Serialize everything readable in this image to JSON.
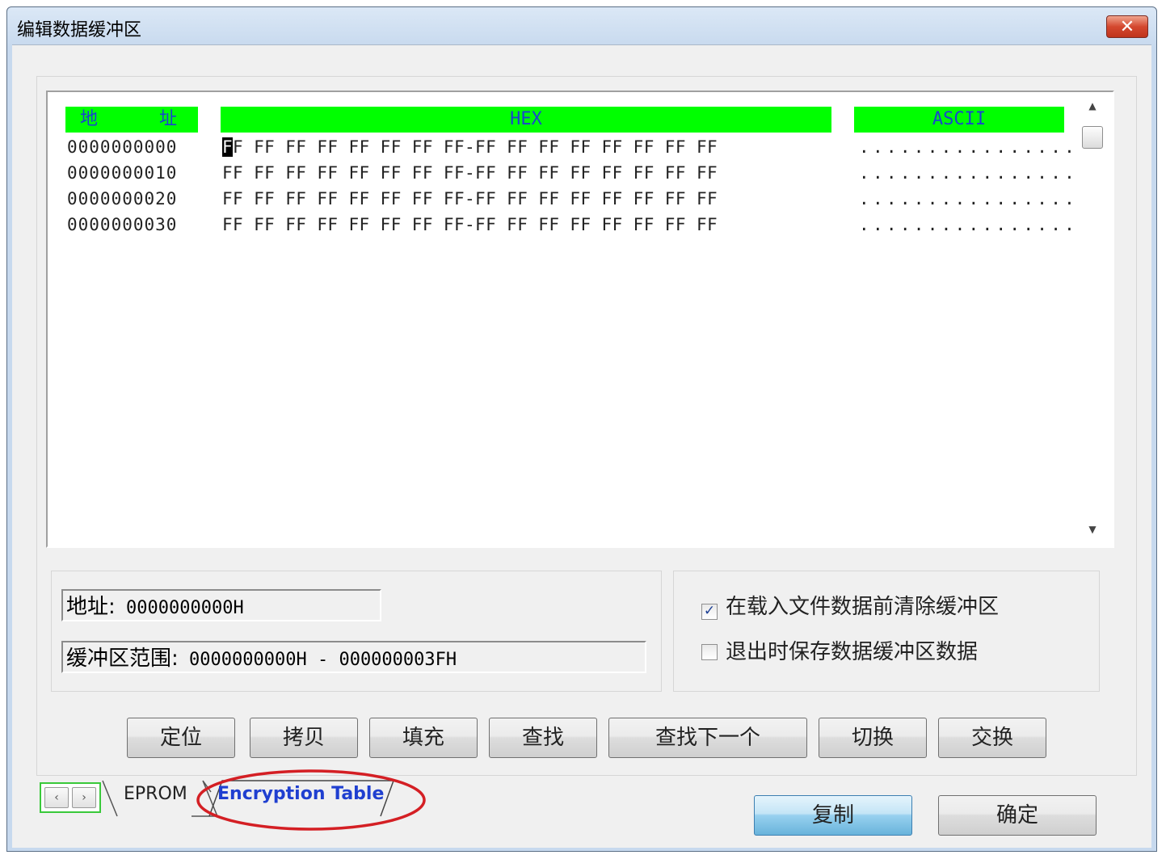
{
  "window": {
    "title": "编辑数据缓冲区",
    "close_label": "✕"
  },
  "grid": {
    "headers": {
      "address_char1": "地",
      "address_char2": "址",
      "hex": "HEX",
      "ascii": "ASCII"
    },
    "rows": [
      {
        "address": "0000000000",
        "cursor_char": "F",
        "hex_rest": "F FF FF FF FF FF FF FF-FF FF FF FF FF FF FF FF",
        "ascii": "................"
      },
      {
        "address": "0000000010",
        "hex": "FF FF FF FF FF FF FF FF-FF FF FF FF FF FF FF FF",
        "ascii": "................"
      },
      {
        "address": "0000000020",
        "hex": "FF FF FF FF FF FF FF FF-FF FF FF FF FF FF FF FF",
        "ascii": "................"
      },
      {
        "address": "0000000030",
        "hex": "FF FF FF FF FF FF FF FF-FF FF FF FF FF FF FF FF",
        "ascii": "................"
      }
    ]
  },
  "info": {
    "address_label": "地址:",
    "address_value": "0000000000H",
    "range_label": "缓冲区范围:",
    "range_value": "0000000000H - 000000003FH"
  },
  "options": {
    "clear_before_load": {
      "label": "在载入文件数据前清除缓冲区",
      "checked": true,
      "mark": "✓"
    },
    "save_on_exit": {
      "label": "退出时保存数据缓冲区数据",
      "checked": false,
      "mark": ""
    }
  },
  "buttons": {
    "locate": "定位",
    "copy": "拷贝",
    "fill": "填充",
    "find": "查找",
    "find_next": "查找下一个",
    "switch": "切换",
    "swap": "交换",
    "duplicate": "复制",
    "ok": "确定"
  },
  "tabs": {
    "prev_arrow": "‹",
    "next_arrow": "›",
    "eprom": "EPROM",
    "encryption": "Encryption Table"
  },
  "colors": {
    "header_bg": "#00ff00",
    "header_text": "#1a44d0",
    "highlight_ellipse": "#d41f24",
    "active_tab_text": "#1f3fd0"
  }
}
